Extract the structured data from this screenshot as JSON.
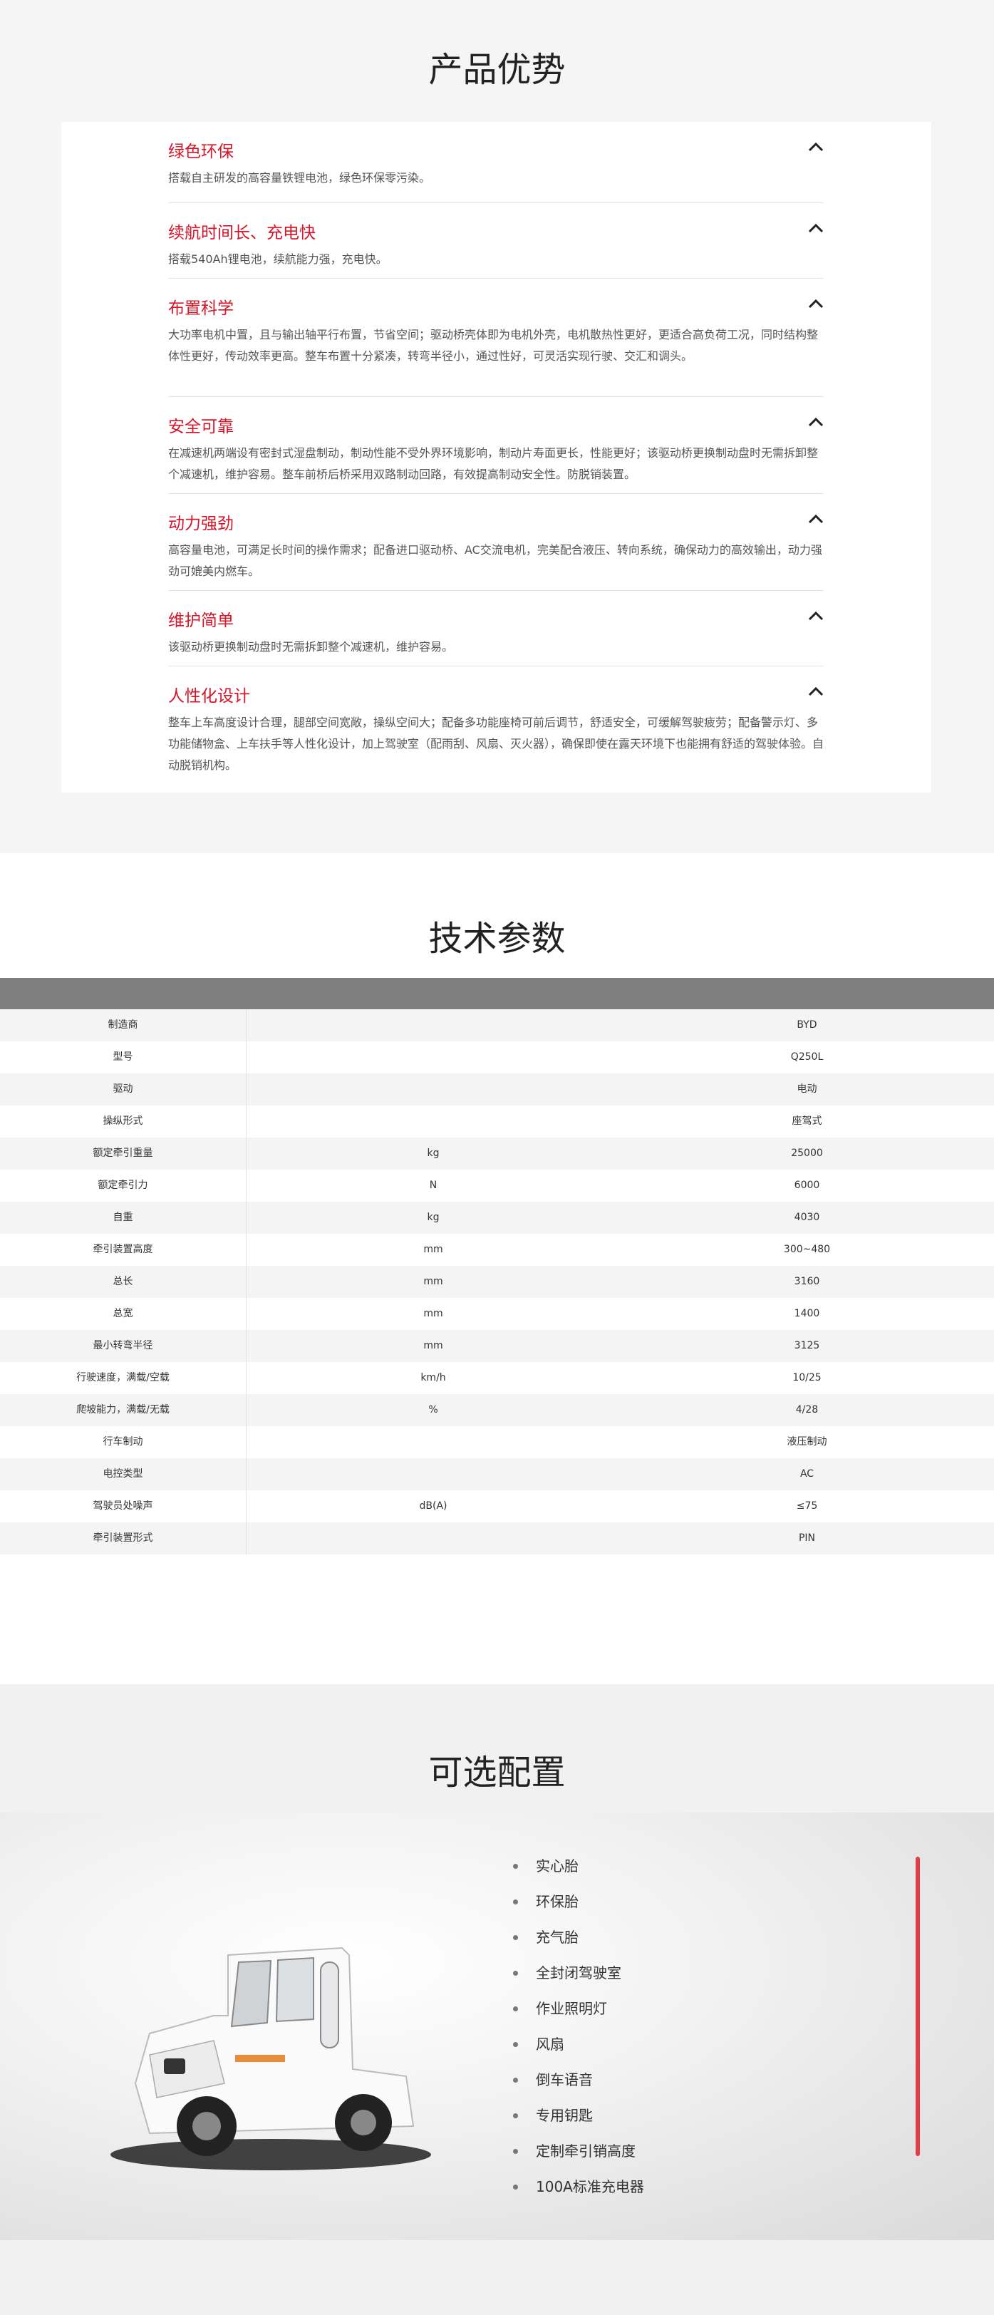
{
  "advantages": {
    "title": "产品优势",
    "items": [
      {
        "title": "绿色环保",
        "desc": "搭载自主研发的高容量铁锂电池，绿色环保零污染。"
      },
      {
        "title": "续航时间长、充电快",
        "desc": "搭载540Ah锂电池，续航能力强，充电快。"
      },
      {
        "title": "布置科学",
        "desc": "大功率电机中置，且与输出轴平行布置，节省空间；驱动桥壳体即为电机外壳，电机散热性更好，更适合高负荷工况，同时结构整体性更好，传动效率更高。整车布置十分紧凑，转弯半径小，通过性好，可灵活实现行驶、交汇和调头。"
      },
      {
        "title": "安全可靠",
        "desc": "在减速机两端设有密封式湿盘制动，制动性能不受外界环境影响，制动片寿面更长，性能更好；该驱动桥更换制动盘时无需拆卸整个减速机，维护容易。整车前桥后桥采用双路制动回路，有效提高制动安全性。防脱销装置。"
      },
      {
        "title": "动力强劲",
        "desc": "高容量电池，可满足长时间的操作需求；配备进口驱动桥、AC交流电机，完美配合液压、转向系统，确保动力的高效输出，动力强劲可媲美内燃车。"
      },
      {
        "title": "维护简单",
        "desc": "该驱动桥更换制动盘时无需拆卸整个减速机，维护容易。"
      },
      {
        "title": "人性化设计",
        "desc": "整车上车高度设计合理，腿部空间宽敞，操纵空间大；配备多功能座椅可前后调节，舒适安全，可缓解驾驶疲劳；配备警示灯、多功能储物盒、上车扶手等人性化设计，加上驾驶室（配雨刮、风扇、灭火器），确保即使在露天环境下也能拥有舒适的驾驶体验。自动脱销机构。"
      }
    ]
  },
  "tech": {
    "title": "技术参数",
    "rows": [
      {
        "name": "制造商",
        "unit": "",
        "value": "BYD"
      },
      {
        "name": "型号",
        "unit": "",
        "value": "Q250L"
      },
      {
        "name": "驱动",
        "unit": "",
        "value": "电动"
      },
      {
        "name": "操纵形式",
        "unit": "",
        "value": "座驾式"
      },
      {
        "name": "额定牵引重量",
        "unit": "kg",
        "value": "25000"
      },
      {
        "name": "额定牵引力",
        "unit": "N",
        "value": "6000"
      },
      {
        "name": "自重",
        "unit": "kg",
        "value": "4030"
      },
      {
        "name": "牵引装置高度",
        "unit": "mm",
        "value": "300~480"
      },
      {
        "name": "总长",
        "unit": "mm",
        "value": "3160"
      },
      {
        "name": "总宽",
        "unit": "mm",
        "value": "1400"
      },
      {
        "name": "最小转弯半径",
        "unit": "mm",
        "value": "3125"
      },
      {
        "name": "行驶速度，满载/空载",
        "unit": "km/h",
        "value": "10/25"
      },
      {
        "name": "爬坡能力，满载/无载",
        "unit": "%",
        "value": "4/28"
      },
      {
        "name": "行车制动",
        "unit": "",
        "value": "液压制动"
      },
      {
        "name": "电控类型",
        "unit": "",
        "value": "AC"
      },
      {
        "name": "驾驶员处噪声",
        "unit": "dB(A)",
        "value": "≤75"
      },
      {
        "name": "牵引装置形式",
        "unit": "",
        "value": "PIN"
      }
    ]
  },
  "options": {
    "title": "可选配置",
    "items": [
      "实心胎",
      "环保胎",
      "充气胎",
      "全封闭驾驶室",
      "作业照明灯",
      "风扇",
      "倒车语音",
      "专用钥匙",
      "定制牵引销高度",
      "100A标准充电器"
    ]
  },
  "colors": {
    "accent": "#d7152a",
    "header_gray": "#7f7f7f",
    "bar_red": "#e33b47"
  }
}
